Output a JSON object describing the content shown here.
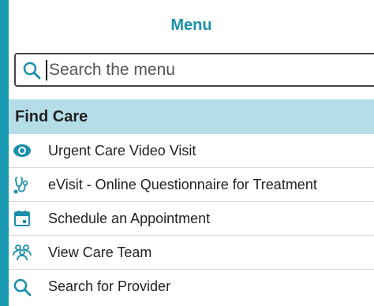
{
  "menu": {
    "title": "Menu"
  },
  "search": {
    "placeholder": "Search the menu"
  },
  "section": {
    "title": "Find Care"
  },
  "items": [
    {
      "label": "Urgent Care Video Visit",
      "icon": "video-camera-icon"
    },
    {
      "label": "eVisit - Online Questionnaire for Treatment",
      "icon": "stethoscope-icon"
    },
    {
      "label": "Schedule an Appointment",
      "icon": "calendar-icon"
    },
    {
      "label": "View Care Team",
      "icon": "care-team-icon"
    },
    {
      "label": "Search for Provider",
      "icon": "search-icon"
    }
  ],
  "colors": {
    "accent": "#1a8fab",
    "border": "#1a9ab2",
    "section_bg": "#b5dde8"
  }
}
